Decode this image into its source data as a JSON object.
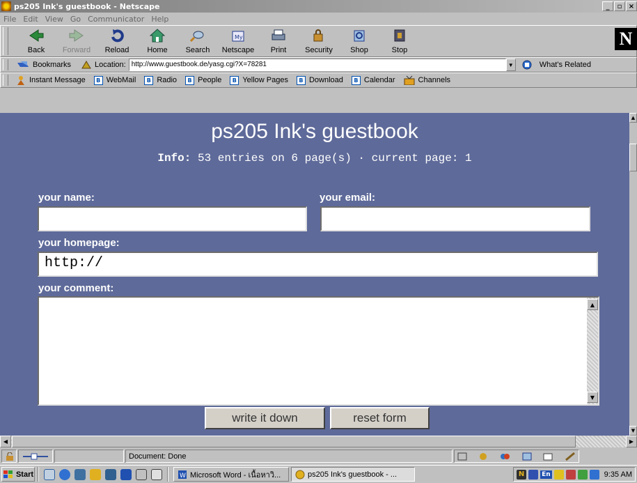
{
  "window": {
    "title": "ps205 Ink's guestbook - Netscape",
    "min": "_",
    "max": "▫",
    "close": "×"
  },
  "menu": [
    "File",
    "Edit",
    "View",
    "Go",
    "Communicator",
    "Help"
  ],
  "toolbar": {
    "buttons": [
      {
        "label": "Back",
        "icon": "back-arrow-icon"
      },
      {
        "label": "Forward",
        "icon": "forward-arrow-icon",
        "disabled": true
      },
      {
        "label": "Reload",
        "icon": "reload-icon"
      },
      {
        "label": "Home",
        "icon": "home-icon"
      },
      {
        "label": "Search",
        "icon": "search-icon"
      },
      {
        "label": "Netscape",
        "icon": "netscape-icon"
      },
      {
        "label": "Print",
        "icon": "print-icon"
      },
      {
        "label": "Security",
        "icon": "lock-icon"
      },
      {
        "label": "Shop",
        "icon": "shop-icon"
      },
      {
        "label": "Stop",
        "icon": "stop-icon"
      }
    ],
    "logo": "N"
  },
  "location": {
    "bookmarks_label": "Bookmarks",
    "location_label": "Location:",
    "url": "http://www.guestbook.de/yasg.cgi?X=78281",
    "whats_related": "What's Related"
  },
  "personal_toolbar": [
    "Instant Message",
    "WebMail",
    "Radio",
    "People",
    "Yellow Pages",
    "Download",
    "Calendar",
    "Channels"
  ],
  "page": {
    "title": "ps205 Ink's guestbook",
    "info_label": "Info:",
    "info_text": "53 entries on 6 page(s) · current page: 1",
    "name_label": "your name:",
    "email_label": "your email:",
    "homepage_label": "your homepage:",
    "homepage_value": "http://",
    "comment_label": "your comment:",
    "submit_label": "write it down",
    "reset_label": "reset form",
    "background_color": "#5e6a99"
  },
  "status": {
    "text": "Document: Done"
  },
  "taskbar": {
    "start_label": "Start",
    "tasks": [
      "Microsoft Word - เนื้อหาวิ...",
      "ps205 Ink's guestbook - ..."
    ],
    "clock": "9:35 AM",
    "lang": "En"
  }
}
